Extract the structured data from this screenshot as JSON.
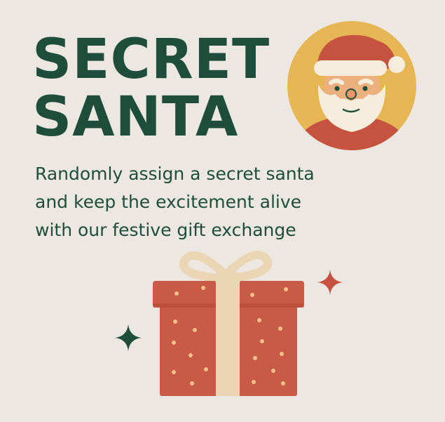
{
  "headline": {
    "line1": "SECRET",
    "line2": "SANTA"
  },
  "tagline": {
    "line1": "Randomly assign a secret santa",
    "line2": "and keep the excitement alive",
    "line3": "with our festive gift exchange"
  },
  "icons": {
    "santa": "santa-claus-icon",
    "gift": "gift-box-icon",
    "sparkle_green": "sparkle-icon",
    "sparkle_red": "sparkle-icon"
  },
  "colors": {
    "background": "#ece7e1",
    "text_green": "#1f4d3b",
    "santa_red": "#c5533f",
    "circle_yellow": "#e7b654",
    "beard_cream": "#f6eddc",
    "ribbon_cream": "#ead6b5",
    "gift_red": "#c95a45",
    "dot_gold": "#efc188"
  }
}
